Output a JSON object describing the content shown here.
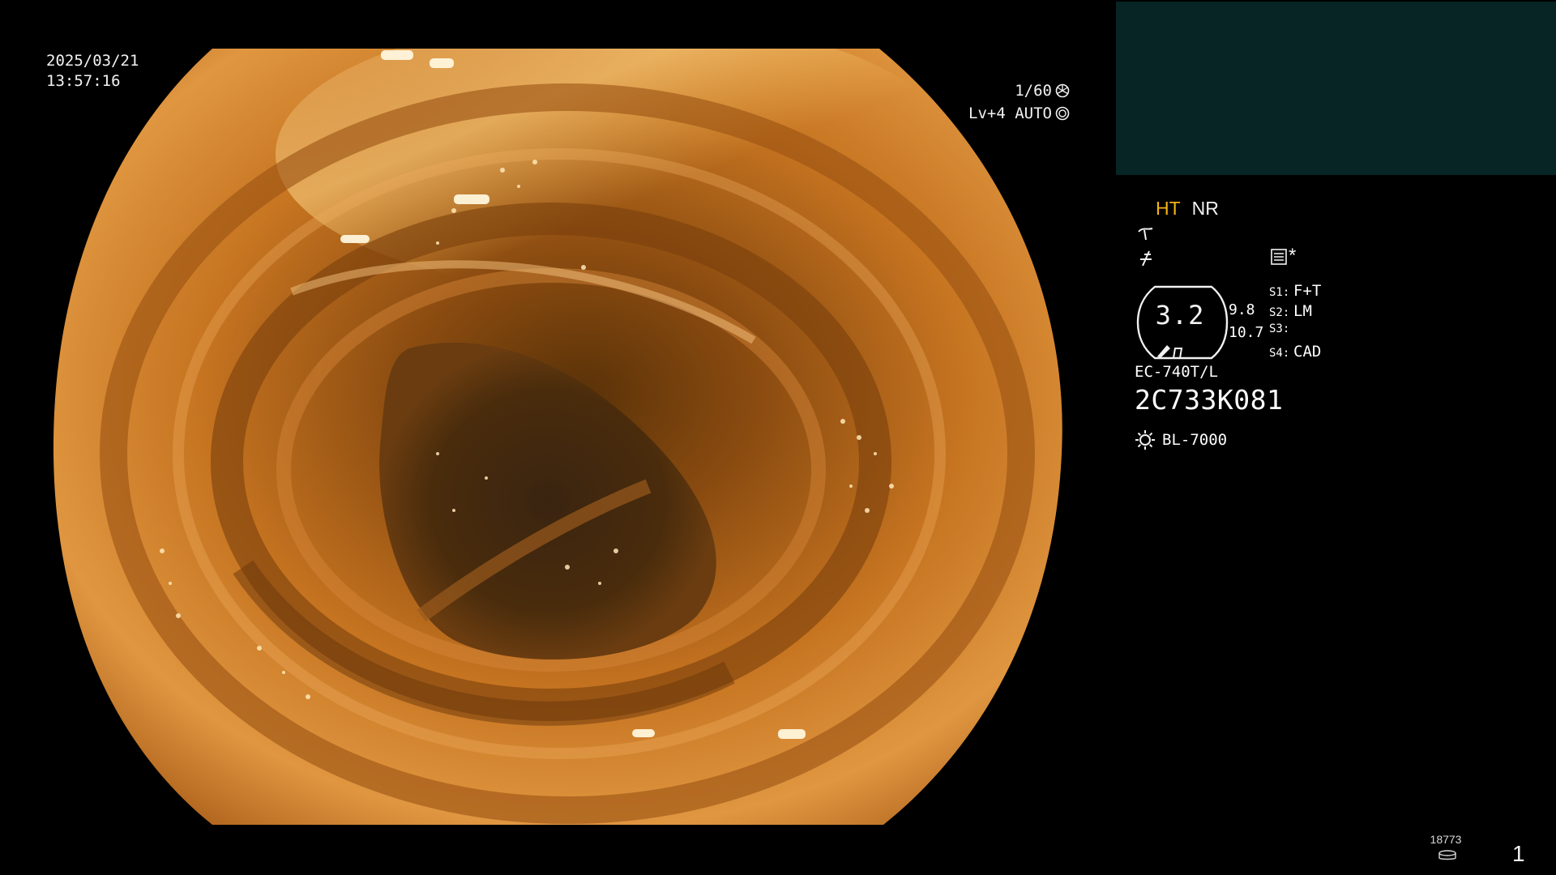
{
  "overlay": {
    "date": "2025/03/21",
    "time": "13:57:16",
    "shutter": "1/60",
    "level_mode": "Lv+4 AUTO"
  },
  "status": {
    "mode_ht": "HT",
    "mode_nr": "NR",
    "zoom": "3.2",
    "zoom_value_1": "9.8",
    "zoom_value_2": "10.7",
    "switches": [
      {
        "key": "S1:",
        "value": "F+T"
      },
      {
        "key": "S2:",
        "value": "LM"
      },
      {
        "key": "S3:",
        "value": ""
      },
      {
        "key": "S4:",
        "value": "CAD"
      }
    ],
    "asterisk": "*",
    "scope_model": "EC-740T/L",
    "scope_serial": "2C733K081",
    "light_source": "BL-7000"
  },
  "footer": {
    "counter": "18773",
    "page": "1"
  },
  "colors": {
    "ht_accent": "#f3b316",
    "panel_bg": "#062524"
  }
}
